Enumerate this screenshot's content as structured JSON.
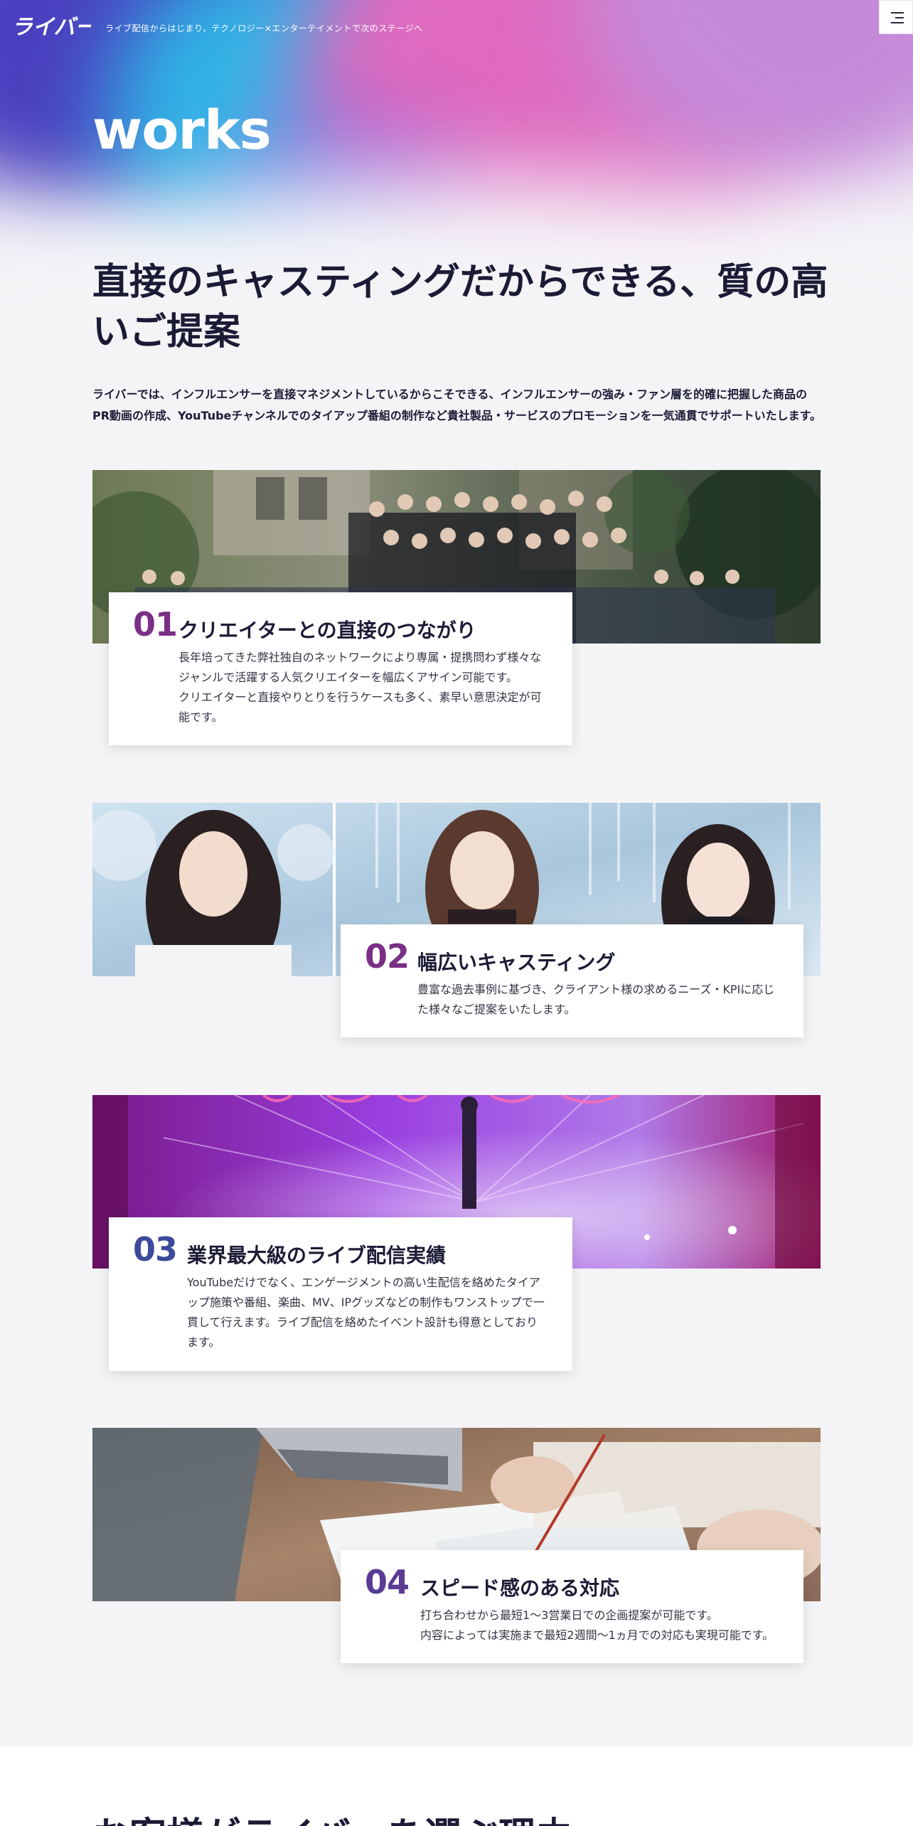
{
  "header": {
    "logo_text": "ライバー",
    "tagline": "ライブ配信からはじまり、テクノロジー×エンターテイメントで次のステージへ",
    "menu_icon": "hamburger-icon"
  },
  "hero": {
    "title": "works"
  },
  "lead": {
    "heading": "直接のキャスティングだからできる、質の高いご提案",
    "intro_lines": [
      "ライバーでは、インフルエンサーを直接マネジメントしているからこそできる、インフルエンサーの強み・ファン層を的確に把握した商品の",
      "PR動画の作成、YouTubeチャンネルでのタイアップ番組の制作など貴社製品・サービスのプロモーションを一気通貫でサポートいたします。"
    ]
  },
  "features": [
    {
      "number": "01",
      "title": "クリエイターとの直接のつながり",
      "desc_lines": [
        "長年培ってきた弊社独自のネットワークにより専属・提携問わず様々な",
        "ジャンルで活躍する人気クリエイターを幅広くアサイン可能です。",
        "クリエイターと直接やりとりを行うケースも多く、素早い意思決定が可",
        "能です。"
      ],
      "image": "group-photo"
    },
    {
      "number": "02",
      "title": "幅広いキャスティング",
      "desc_lines": [
        "豊富な過去事例に基づき、クライアント様の求めるニーズ・KPIに応じ",
        "た様々なご提案をいたします。"
      ],
      "image": "idol-portraits"
    },
    {
      "number": "03",
      "title": "業界最大級のライブ配信実績",
      "desc_lines": [
        "YouTubeだけでなく、エンゲージメントの高い生配信を絡めたタイア",
        "ップ施策や番組、楽曲、MV、IPグッズなどの制作もワンストップで一",
        "貫して行えます。ライブ配信を絡めたイベント設計も得意としており",
        "ます。"
      ],
      "image": "live-stage"
    },
    {
      "number": "04",
      "title": "スピード感のある対応",
      "desc_lines": [
        "打ち合わせから最短1～3営業日での企画提案が可能です。",
        "内容によっては実施まで最短2週間～1ヵ月での対応も実現可能です。"
      ],
      "image": "business-meeting"
    }
  ],
  "next_section": {
    "heading_peek": "お客様がライバーを選ぶ理由"
  },
  "colors": {
    "num_01": "#7a2f86",
    "num_02": "#7a2f86",
    "num_03": "#3b4a9a",
    "num_04": "#5b3a94",
    "text_dark": "#1b1b36",
    "page_bg": "#f4f4f7"
  }
}
